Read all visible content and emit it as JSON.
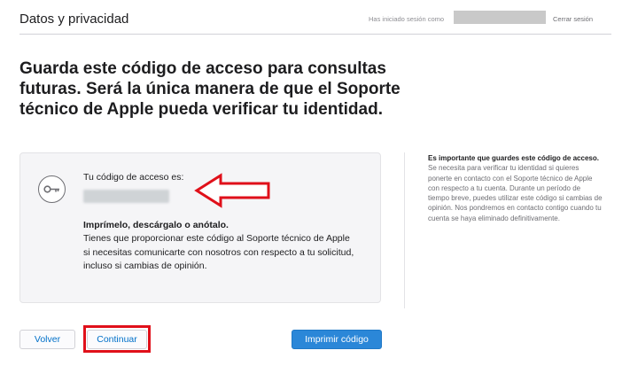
{
  "header": {
    "title": "Datos y privacidad",
    "signed_in_label": "Has iniciado sesión como",
    "signout_label": "Cerrar sesión"
  },
  "headline": "Guarda este código de acceso para consultas futuras. Será la única manera de que el Soporte técnico de Apple pueda verificar tu identidad.",
  "card": {
    "code_label": "Tu código de acceso es:",
    "instructions_title": "Imprímelo, descárgalo o anótalo.",
    "instructions_body": "Tienes que proporcionar este código al Soporte técnico de Apple si necesitas comunicarte con nosotros con respecto a tu solicitud, incluso si cambias de opinión.",
    "icon": "key-icon"
  },
  "side_note": {
    "lead": "Es importante que guardes este código de acceso.",
    "body": " Se necesita para verificar tu identidad si quieres ponerte en contacto con el Soporte técnico de Apple con respecto a tu cuenta. Durante un período de tiempo breve, puedes utilizar este código si cambias de opinión. Nos pondremos en contacto contigo cuando tu cuenta se haya eliminado definitivamente."
  },
  "buttons": {
    "back": "Volver",
    "continue": "Continuar",
    "print": "Imprimir código"
  },
  "colors": {
    "link_blue": "#0070c9",
    "primary_button": "#2b87d8",
    "annotation_red": "#e0101a"
  }
}
